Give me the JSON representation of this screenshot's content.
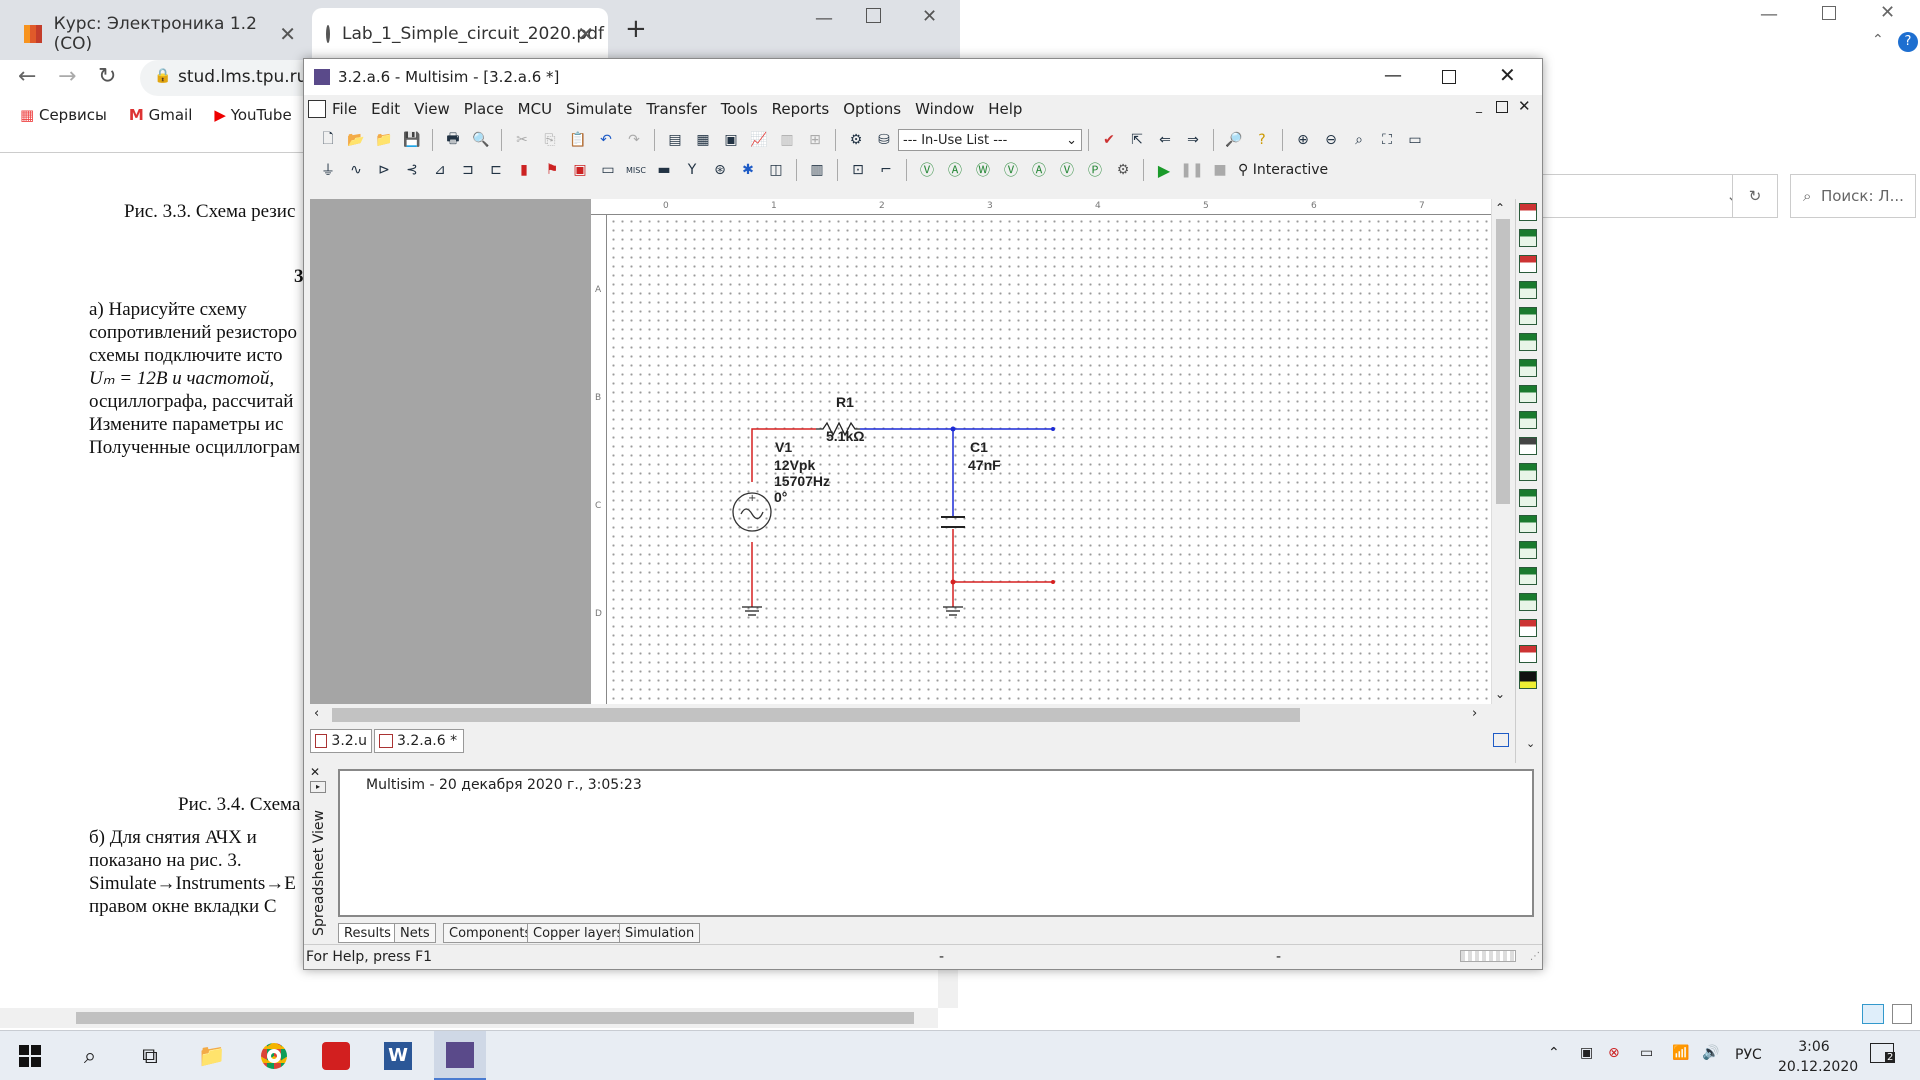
{
  "browser": {
    "tabs": [
      {
        "title": "Курс: Электроника 1.2 (СО)",
        "close": "✕"
      },
      {
        "title": "Lab_1_Simple_circuit_2020.pdf",
        "close": "✕"
      }
    ],
    "new_tab": "+",
    "url": "stud.lms.tpu.ru/",
    "bookmarks": [
      "Сервисы",
      "Gmail",
      "YouTube"
    ]
  },
  "document": {
    "fig33": "Рис. 3.3. Схема резис",
    "sec": "3",
    "para_a": [
      "а) Нарисуйте схему",
      "сопротивлений резисторо",
      "схемы подключите исто",
      "Uₘ = 12В  и  частотой,",
      "осциллографа, рассчитай",
      "Измените параметры ис",
      "Полученные осциллограм"
    ],
    "fig34": "Рис. 3.4. Схема",
    "para_b": [
      "б) Для снятия АЧХ и",
      "показано   на   рис.   3.",
      "Simulate→Instruments→Е",
      "правом  окне  вкладки  С"
    ]
  },
  "explorer": {
    "search_placeholder": "Поиск: Л..."
  },
  "multisim": {
    "title": "3.2.a.6 - Multisim - [3.2.a.6 *]",
    "menu": [
      "File",
      "Edit",
      "View",
      "Place",
      "MCU",
      "Simulate",
      "Transfer",
      "Tools",
      "Reports",
      "Options",
      "Window",
      "Help"
    ],
    "inuse_list": "--- In-Use List ---",
    "interactive": "Interactive",
    "ruler_top": [
      "0",
      "1",
      "2",
      "3",
      "4",
      "5",
      "6",
      "7"
    ],
    "ruler_left": [
      "A",
      "B",
      "C",
      "D"
    ],
    "circuit": {
      "r1_name": "R1",
      "r1_value": "5.1kΩ",
      "v1_name": "V1",
      "v1_amp": "12Vpk",
      "v1_freq": "15707Hz",
      "v1_phase": "0°",
      "c1_name": "C1",
      "c1_value": "47nF",
      "wire_blue": "#1c2ad6",
      "wire_red": "#d62020"
    },
    "doc_tabs": [
      "3.2.u",
      "3.2.a.6 *"
    ],
    "spreadsheet_view": "Spreadsheet View",
    "output_message": "Multisim  -  20 декабря 2020 г., 3:05:23",
    "output_tabs": [
      "Results",
      "Nets",
      "Components",
      "Copper layers",
      "Simulation"
    ],
    "status": "For Help, press F1",
    "status_dash1": "-",
    "status_dash2": "-"
  },
  "taskbar": {
    "lang": "РУС",
    "time": "3:06",
    "date": "20.12.2020",
    "notifications": "2"
  }
}
